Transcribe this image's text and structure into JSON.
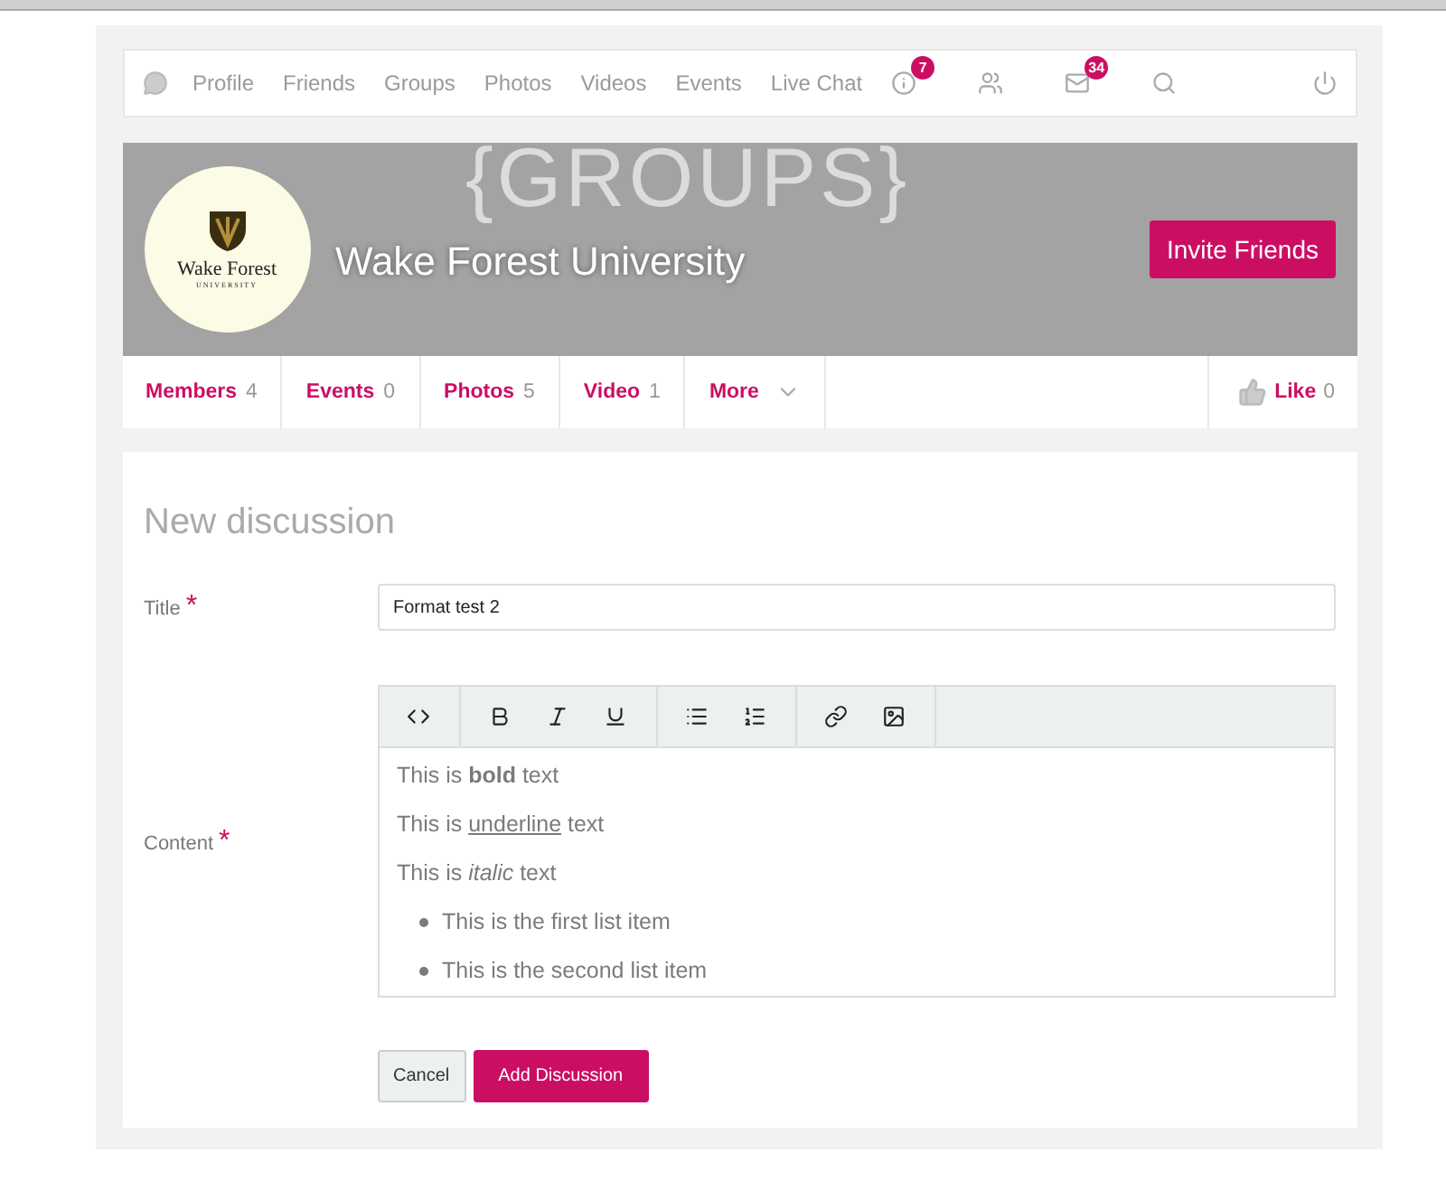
{
  "nav": {
    "links": [
      "Profile",
      "Friends",
      "Groups",
      "Photos",
      "Videos",
      "Events",
      "Live Chat"
    ],
    "icons": [
      {
        "kind": "info",
        "badge": "7"
      },
      {
        "kind": "people"
      },
      {
        "kind": "mail",
        "badge": "34"
      },
      {
        "kind": "search"
      }
    ]
  },
  "cover": {
    "watermark": "{GROUPS}",
    "logo": {
      "name": "Wake Forest",
      "subtitle": "UNIVERSITY"
    },
    "title": "Wake Forest University",
    "button": "Invite Friends"
  },
  "tabs": [
    {
      "label": "Members",
      "count": "4"
    },
    {
      "label": "Events",
      "count": "0"
    },
    {
      "label": "Photos",
      "count": "5"
    },
    {
      "label": "Video",
      "count": "1"
    },
    {
      "label": "More"
    }
  ],
  "like": {
    "label": "Like",
    "count": "0"
  },
  "form": {
    "heading": "New discussion",
    "title_field": {
      "label": "Title",
      "required_mark": "*",
      "value": "Format test 2"
    },
    "content_field": {
      "label": "Content",
      "required_mark": "*",
      "toolbar": [
        [
          {
            "kind": "code"
          }
        ],
        [
          {
            "kind": "bold"
          },
          {
            "kind": "italic"
          },
          {
            "kind": "underline"
          }
        ],
        [
          {
            "kind": "bullets"
          },
          {
            "kind": "numbers"
          }
        ],
        [
          {
            "kind": "link"
          },
          {
            "kind": "image"
          }
        ]
      ],
      "lines": [
        {
          "kind": "paragraph",
          "parts": [
            {
              "text": "This is ",
              "kind": "plain"
            },
            {
              "text": "bold",
              "kind": "bold"
            },
            {
              "text": " text",
              "kind": "plain"
            }
          ]
        },
        {
          "kind": "paragraph",
          "parts": [
            {
              "text": "This is ",
              "kind": "plain"
            },
            {
              "text": "underline",
              "kind": "underline"
            },
            {
              "text": " text",
              "kind": "plain"
            }
          ]
        },
        {
          "kind": "paragraph",
          "parts": [
            {
              "text": "This is ",
              "kind": "plain"
            },
            {
              "text": "italic",
              "kind": "italic"
            },
            {
              "text": " text",
              "kind": "plain"
            }
          ]
        },
        {
          "kind": "bullet",
          "parts": [
            {
              "text": "This is the first list item",
              "kind": "plain"
            }
          ]
        },
        {
          "kind": "bullet",
          "parts": [
            {
              "text": "This is the second list item",
              "kind": "plain"
            }
          ]
        }
      ]
    },
    "cancel": "Cancel",
    "submit": "Add Discussion"
  }
}
